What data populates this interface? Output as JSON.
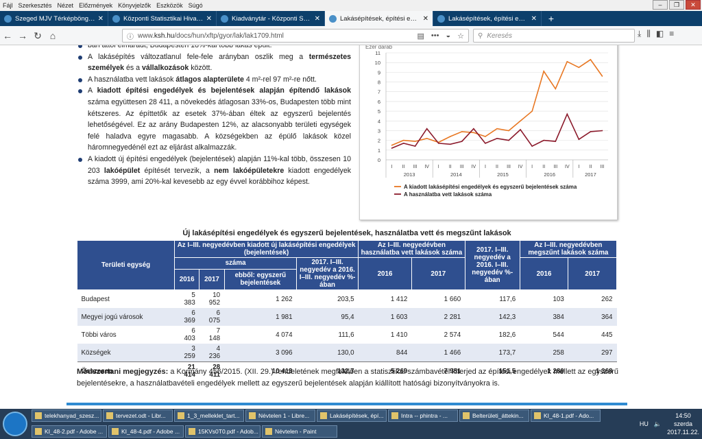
{
  "menu": [
    "Fájl",
    "Szerkesztés",
    "Nézet",
    "Előzmények",
    "Könyvjelzők",
    "Eszközök",
    "Súgó"
  ],
  "tabs": [
    {
      "label": "Szeged MJV Térképböngésző",
      "active": false
    },
    {
      "label": "Központi Statisztikai Hivatal",
      "active": false
    },
    {
      "label": "Kiadványtár - Központi Statiszt",
      "active": false
    },
    {
      "label": "Lakásépítések, építési engedély",
      "active": true
    },
    {
      "label": "Lakásépítések, építési engedély",
      "active": false
    }
  ],
  "url": {
    "prefix": "www.",
    "domain": "ksh.hu",
    "path": "/docs/hun/xftp/gyor/lak/lak1709.html"
  },
  "search_placeholder": "Keresés",
  "bullets": [
    {
      "parts": [
        {
          "t": "ban attól elmaradt, Budapesten 18%-kal több lakás épült.",
          "b": false
        }
      ]
    },
    {
      "parts": [
        {
          "t": "A lakásépítés változatlanul fele-fele arányban oszlik meg a ",
          "b": false
        },
        {
          "t": "természetes személyek",
          "b": true
        },
        {
          "t": " és a ",
          "b": false
        },
        {
          "t": "vállalkozások",
          "b": true
        },
        {
          "t": " között.",
          "b": false
        }
      ]
    },
    {
      "parts": [
        {
          "t": "A használatba vett lakások ",
          "b": false
        },
        {
          "t": "átlagos alapterülete",
          "b": true
        },
        {
          "t": " 4 m²-rel 97 m²-re nőtt.",
          "b": false
        }
      ]
    },
    {
      "parts": [
        {
          "t": "A ",
          "b": false
        },
        {
          "t": "kiadott építési engedélyek és bejelentések alapján építendő lakások",
          "b": true
        },
        {
          "t": " száma együttesen 28 411, a növekedés átlagosan 33%-os, Budapesten több mint kétszeres. Az építtetők az esetek 37%-ában éltek az egyszerű bejelentés lehetőségével. Ez az arány Budapesten 12%, az alacsonyabb területi egységek felé haladva egyre magasabb. A községekben az épülő lakások közel háromnegyedénél ezt az eljárást alkalmazzák.",
          "b": false
        }
      ]
    },
    {
      "parts": [
        {
          "t": "A kiadott új építési engedélyek (bejelentések) alapján 11%-kal több, összesen 10 203 ",
          "b": false
        },
        {
          "t": "lakóépület",
          "b": true
        },
        {
          "t": " építését tervezik, a ",
          "b": false
        },
        {
          "t": "nem lakóépületekre",
          "b": true
        },
        {
          "t": " kiadott engedélyek száma 3999, ami 20%-kal kevesebb az egy évvel korábbihoz képest.",
          "b": false
        }
      ]
    }
  ],
  "chart_data": {
    "type": "line",
    "unit_label": "Ezer darab",
    "ylim": [
      0,
      11
    ],
    "yticks": [
      0,
      1,
      2,
      3,
      4,
      5,
      6,
      7,
      8,
      9,
      10,
      11
    ],
    "quarters": [
      "I",
      "II",
      "III",
      "IV",
      "I",
      "II",
      "III",
      "IV",
      "I",
      "II",
      "III",
      "IV",
      "I",
      "II",
      "III",
      "IV",
      "I",
      "II",
      "III"
    ],
    "years": [
      "2013",
      "2014",
      "2015",
      "2016",
      "2017"
    ],
    "series": [
      {
        "name": "A kiadott lakásépítési engedélyek és egyszerű bejelentések száma",
        "color": "#e87722",
        "values": [
          1.5,
          2.0,
          1.9,
          2.2,
          1.8,
          2.4,
          2.9,
          2.8,
          2.4,
          3.2,
          3.0,
          4.0,
          5.0,
          9.1,
          7.3,
          10.1,
          9.5,
          10.3,
          8.6
        ]
      },
      {
        "name": "A használatba vett lakások száma",
        "color": "#8b1a2b",
        "values": [
          1.2,
          1.7,
          1.4,
          3.2,
          1.7,
          1.6,
          1.9,
          3.2,
          1.7,
          2.2,
          2.0,
          3.1,
          1.4,
          2.0,
          1.9,
          4.7,
          2.1,
          2.9,
          3.0
        ]
      }
    ]
  },
  "table": {
    "title": "Új lakásépítési engedélyek és egyszerű bejelentések, használatba vett és megszűnt lakások",
    "h_region": "Területi egység",
    "h_group1": "Az I–III. negyedévben kiadott új lakásépítési engedélyek (bejelentések)",
    "h_szama": "száma",
    "h_2016": "2016",
    "h_2017": "2017",
    "h_ebbol": "ebből: egyszerű bejelentések",
    "h_pct1": "2017. I–III. negyedév a 2016. I–III. negyedév %-ában",
    "h_group2": "Az I–III. negyedévben használatba vett lakások száma",
    "h_pct2": "2017. I–III. negyedév a 2016. I–III. negyedév %-ában",
    "h_group3": "Az I–III. negyedévben megszűnt lakások száma",
    "rows": [
      [
        "Budapest",
        "5 383",
        "10 952",
        "1 262",
        "203,5",
        "1 412",
        "1 660",
        "117,6",
        "103",
        "262"
      ],
      [
        "Megyei jogú városok",
        "6 369",
        "6 075",
        "1 981",
        "95,4",
        "1 603",
        "2 281",
        "142,3",
        "384",
        "364"
      ],
      [
        "Többi város",
        "6 403",
        "7 148",
        "4 074",
        "111,6",
        "1 410",
        "2 574",
        "182,6",
        "544",
        "445"
      ],
      [
        "Községek",
        "3 259",
        "4 236",
        "3 096",
        "130,0",
        "844",
        "1 466",
        "173,7",
        "258",
        "297"
      ],
      [
        "Összesen",
        "21 414",
        "28 411",
        "10 413",
        "132,7",
        "5 269",
        "7 981",
        "151,5",
        "1 289",
        "1 368"
      ]
    ]
  },
  "method": {
    "label": "Módszertani megjegyzés:",
    "text": " a Kormány 456/2015. (XII. 29.) rendeletének megfelelően a statisztikai számbavétel kiterjed az építési engedélyek mellett az egyszerű bejelentésekre, a használatbavételi engedélyek mellett az egyszerű bejelentések alapján kiállított hatósági bizonyítványokra is."
  },
  "taskbar": {
    "row1": [
      "telekhanyad_szesz...",
      "tervezet.odt - Libr...",
      "1_3_melleklet_tart...",
      "Névtelen 1 - Libre...",
      "Lakásépítések, épí...",
      "Intra -- phintra - ...",
      "Belterületi_áttekin...",
      "KI_48-1.pdf - Ado..."
    ],
    "row2": [
      "KI_48-2.pdf - Adobe ...",
      "KI_48-4.pdf - Adobe ...",
      "15KVs0T0.pdf - Adob...",
      "Névtelen - Paint"
    ],
    "lang": "HU",
    "time": "14:50",
    "day": "szerda",
    "date": "2017.11.22."
  }
}
